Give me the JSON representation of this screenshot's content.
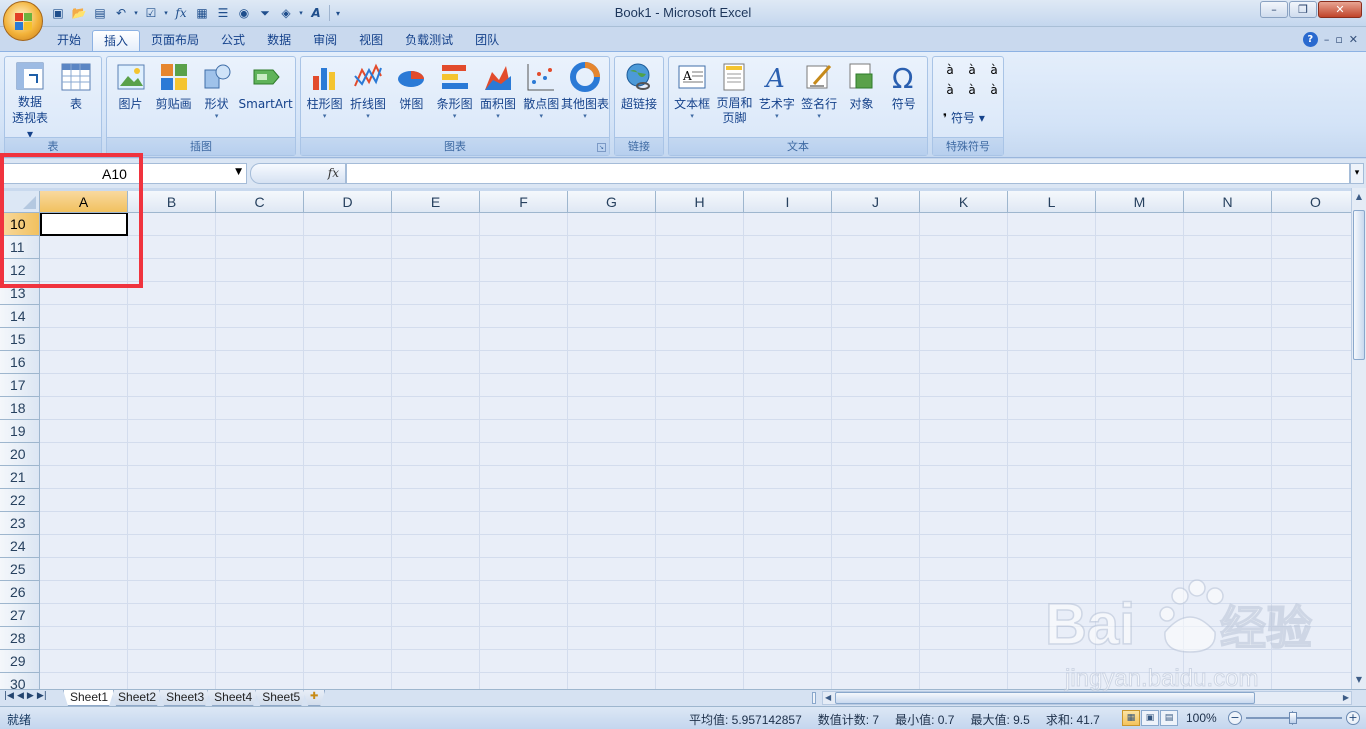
{
  "window": {
    "title": "Book1 - Microsoft Excel",
    "minimize": "–",
    "restore": "❐",
    "close": "✕"
  },
  "ribbon_tabs": [
    {
      "label": "开始"
    },
    {
      "label": "插入",
      "active": true
    },
    {
      "label": "页面布局"
    },
    {
      "label": "公式"
    },
    {
      "label": "数据"
    },
    {
      "label": "审阅"
    },
    {
      "label": "视图"
    },
    {
      "label": "负载测试"
    },
    {
      "label": "团队"
    }
  ],
  "ribbon_right": {
    "help": "?",
    "min": "–",
    "restore": "▫",
    "close": "✕"
  },
  "groups": {
    "table": {
      "label": "表",
      "items": [
        {
          "label": "数据\n透视表 ▾"
        },
        {
          "label": "表"
        }
      ]
    },
    "illustrations": {
      "label": "插图",
      "items": [
        {
          "label": "图片"
        },
        {
          "label": "剪贴画"
        },
        {
          "label": "形状"
        },
        {
          "label": "SmartArt"
        }
      ]
    },
    "charts": {
      "label": "图表",
      "items": [
        {
          "label": "柱形图"
        },
        {
          "label": "折线图"
        },
        {
          "label": "饼图"
        },
        {
          "label": "条形图"
        },
        {
          "label": "面积图"
        },
        {
          "label": "散点图"
        },
        {
          "label": "其他图表"
        }
      ]
    },
    "links": {
      "label": "链接",
      "items": [
        {
          "label": "超链接"
        }
      ]
    },
    "text": {
      "label": "文本",
      "items": [
        {
          "label": "文本框"
        },
        {
          "label": "页眉和\n页脚"
        },
        {
          "label": "艺术字"
        },
        {
          "label": "签名行"
        },
        {
          "label": "对象"
        },
        {
          "label": "符号"
        }
      ]
    },
    "special": {
      "label": "特殊符号",
      "symbols": [
        "à",
        "à",
        "à",
        "à",
        "à",
        "à"
      ],
      "more_label": "符号 ▾"
    }
  },
  "formula_bar": {
    "name_box": "A10",
    "fx": "fx",
    "value": ""
  },
  "columns": [
    "A",
    "B",
    "C",
    "D",
    "E",
    "F",
    "G",
    "H",
    "I",
    "J",
    "K",
    "L",
    "M",
    "N",
    "O"
  ],
  "selected_column": "A",
  "rows": [
    "10",
    "11",
    "12",
    "13",
    "14",
    "15",
    "16",
    "17",
    "18",
    "19",
    "20",
    "21",
    "22",
    "23",
    "24",
    "25",
    "26",
    "27",
    "28",
    "29",
    "30"
  ],
  "selected_row": "10",
  "sheets": [
    "Sheet1",
    "Sheet2",
    "Sheet3",
    "Sheet4",
    "Sheet5"
  ],
  "active_sheet": "Sheet1",
  "status": {
    "ready": "就绪",
    "average": "平均值: 5.957142857",
    "count": "数值计数: 7",
    "min": "最小值: 0.7",
    "max": "最大值: 9.5",
    "sum": "求和: 41.7",
    "zoom": "100%"
  },
  "colors": {
    "highlight": "#f0333e",
    "ribbon": "#d3e3f7",
    "selected_header": "#f1c15f"
  }
}
